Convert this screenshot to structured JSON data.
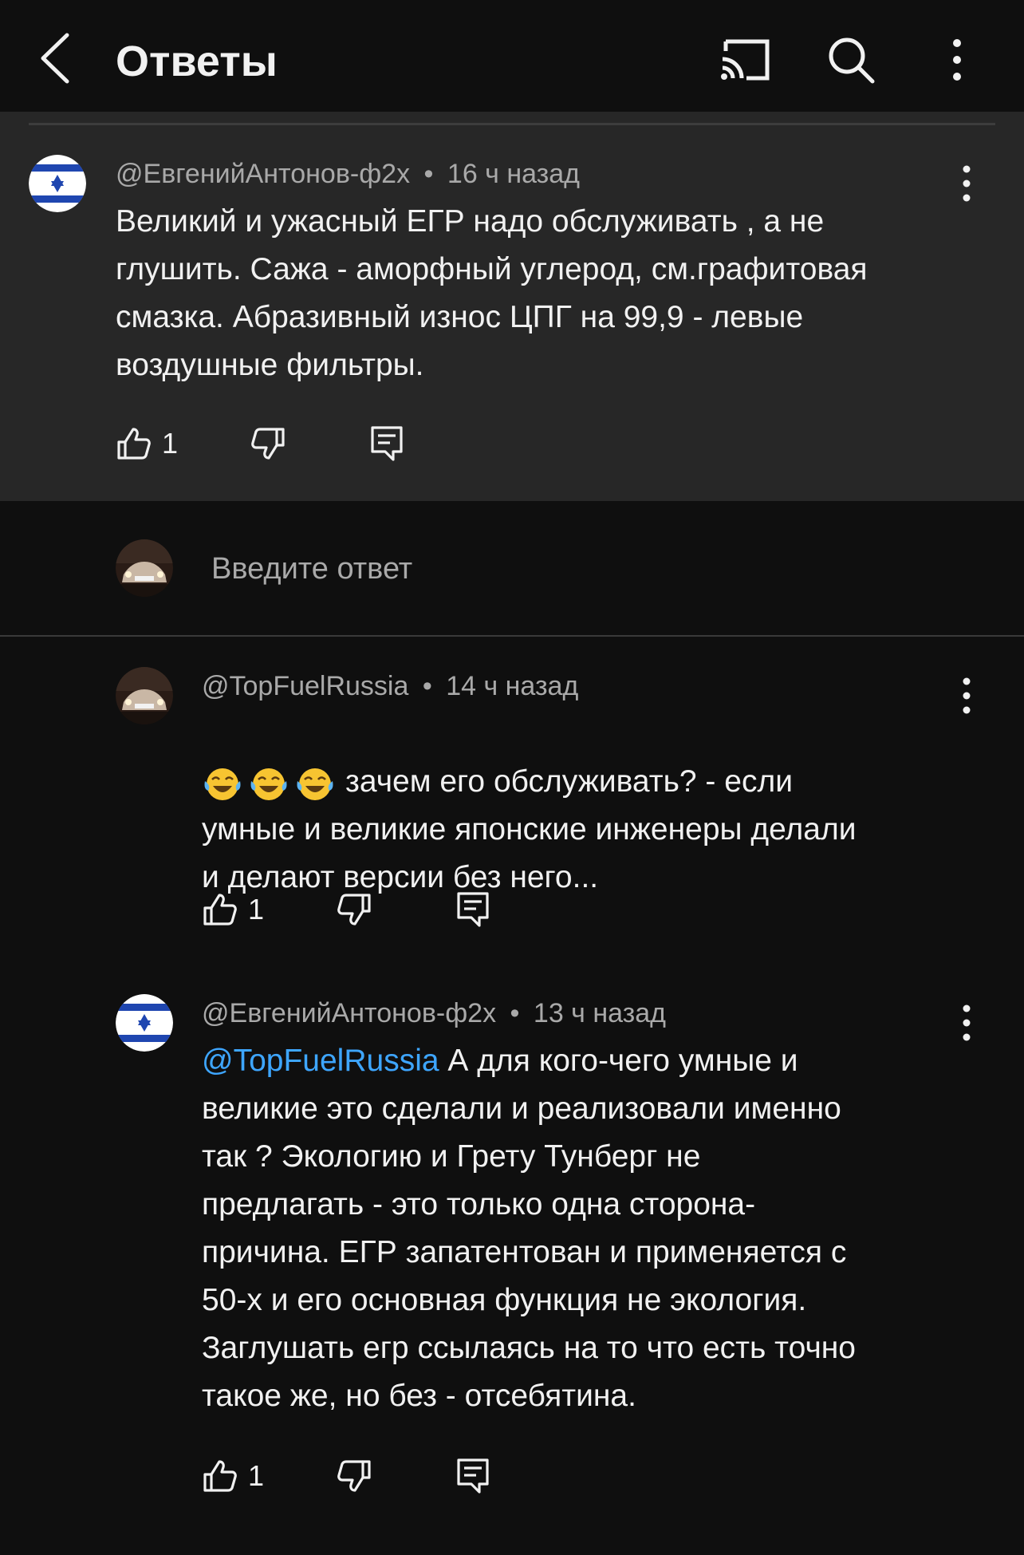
{
  "header": {
    "title": "Ответы",
    "icons": [
      "back-arrow-icon",
      "cast-icon",
      "search-icon",
      "more-vert-icon"
    ]
  },
  "parent_comment": {
    "author": "@ЕвгенийАнтонов-ф2х",
    "dot": "•",
    "time": "16 ч назад",
    "text": "Великий и ужасный ЕГР надо обслуживать , а не\nглушить. Сажа - аморфный углерод, см.графитовая\nсмазка. Абразивный износ ЦПГ на 99,9 - левые\nвоздушные фильтры.",
    "likes": "1"
  },
  "reply_box": {
    "placeholder": "Введите ответ"
  },
  "replies": [
    {
      "author": "@TopFuelRussia",
      "dot": "•",
      "time": "14 ч назад",
      "emoji": "😂😂😂",
      "text": "зачем его обслуживать? - если\nумные и великие японские инженеры делали\nи делают версии без него...",
      "likes": "1"
    },
    {
      "author": "@ЕвгенийАнтонов-ф2х",
      "dot": "•",
      "time": "13 ч назад",
      "mention": "@TopFuelRussia",
      "text": " А для кого-чего умные и\nвеликие это сделали и реализовали именно\nтак ? Экологию и Грету Тунберг  не\nпредлагать - это только одна сторона-\nпричина. ЕГР запатентован и применяется с\n50-х и его основная  функция не экология.\nЗаглушать егр ссылаясь на то что есть  точно\nтакое же, но без - отсебятина.",
      "likes": "1"
    }
  ],
  "colors": {
    "background": "#0f0f0f",
    "parent_highlight": "#272727",
    "meta_text": "#a9a9a9",
    "mention": "#3ea6ff",
    "flag_blue": "#1f46b0"
  }
}
